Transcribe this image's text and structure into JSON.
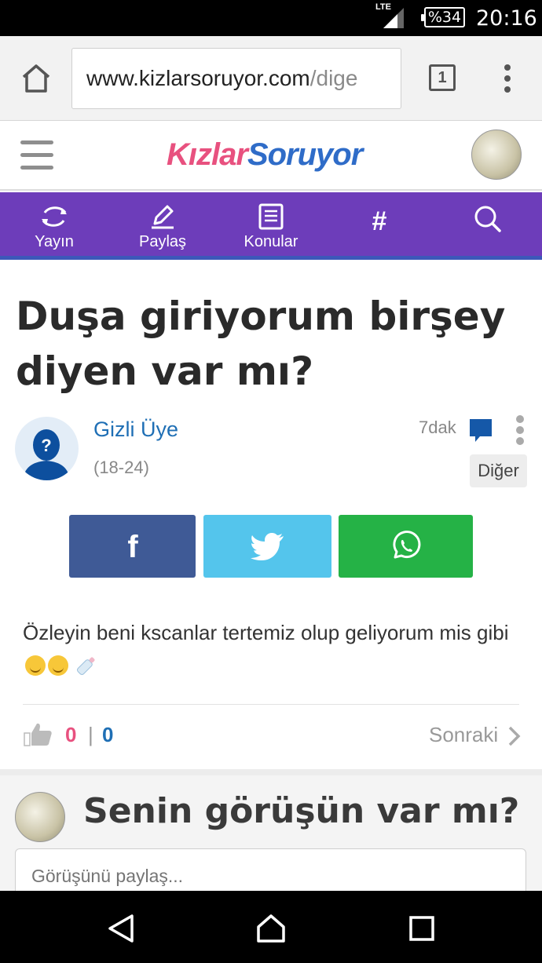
{
  "status_bar": {
    "network": "LTE",
    "battery": "%34",
    "time": "20:16"
  },
  "browser": {
    "url_host": "www.kizlarsoruyor.com",
    "url_path": "/dige",
    "tab_count": "1"
  },
  "site": {
    "logo_part1": "Kızlar",
    "logo_part2": "Soruyor"
  },
  "nav": {
    "items": [
      {
        "label": "Yayın",
        "icon": "refresh-icon"
      },
      {
        "label": "Paylaş",
        "icon": "pencil-icon"
      },
      {
        "label": "Konular",
        "icon": "list-icon"
      },
      {
        "label": "#",
        "icon": "hash-icon"
      },
      {
        "label": "",
        "icon": "search-icon"
      }
    ]
  },
  "question": {
    "title": "Duşa giriyorum birşey diyen var mı?",
    "author": "Gizli Üye",
    "age_range": "(18-24)",
    "time_ago": "7dak",
    "category": "Diğer",
    "body": "Özleyin beni kscanlar tertemiz olup geliyorum mis gibi"
  },
  "share": {
    "facebook": "f",
    "twitter": "twitter-icon",
    "whatsapp": "whatsapp-icon"
  },
  "votes": {
    "up": "0",
    "separator": "|",
    "down": "0",
    "next_label": "Sonraki"
  },
  "opinion": {
    "title": "Senin görüşün var mı?",
    "placeholder": "Görüşünü paylaş..."
  },
  "colors": {
    "nav_bg": "#6d3dba",
    "facebook": "#3f5a96",
    "twitter": "#54c5ec",
    "whatsapp": "#25b246",
    "link": "#1f6fb5",
    "pink": "#e8517f"
  }
}
